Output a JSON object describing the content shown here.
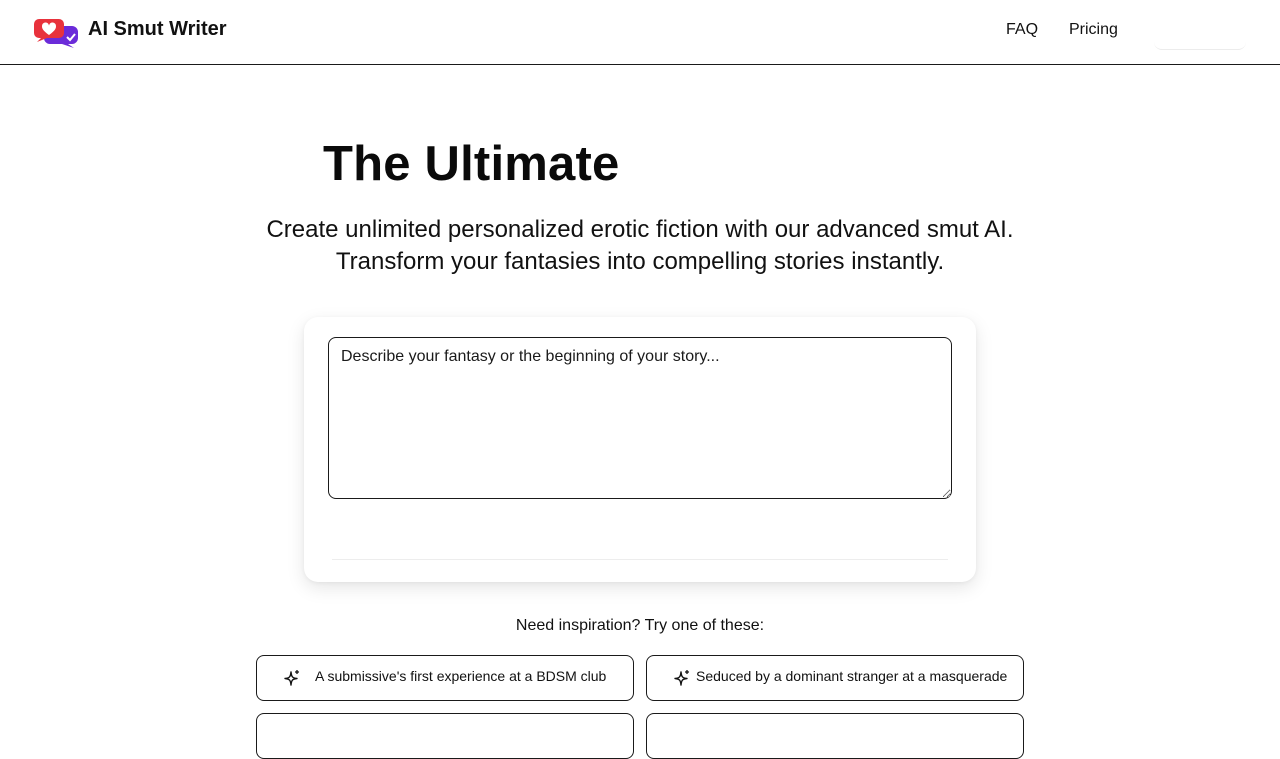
{
  "header": {
    "brand": "AI Smut Writer",
    "logo_icon": "chat-hearts-logo-icon",
    "nav": {
      "faq": "FAQ",
      "pricing": "Pricing"
    }
  },
  "hero": {
    "title": "The Ultimate",
    "subtitle_line1": "Create unlimited personalized erotic fiction with our advanced smut AI.",
    "subtitle_line2": "Transform your fantasies into compelling stories instantly."
  },
  "composer": {
    "placeholder": "Describe your fantasy or the beginning of your story..."
  },
  "inspiration": {
    "heading": "Need inspiration? Try one of these:",
    "icon": "sparkle-icon",
    "prompts": [
      "A submissive's first experience at a BDSM club",
      "Seduced by a dominant stranger at a masquerade"
    ]
  },
  "colors": {
    "logo_red": "#e8323c",
    "logo_purple": "#6b2bd9",
    "border": "#1a1a1a"
  }
}
